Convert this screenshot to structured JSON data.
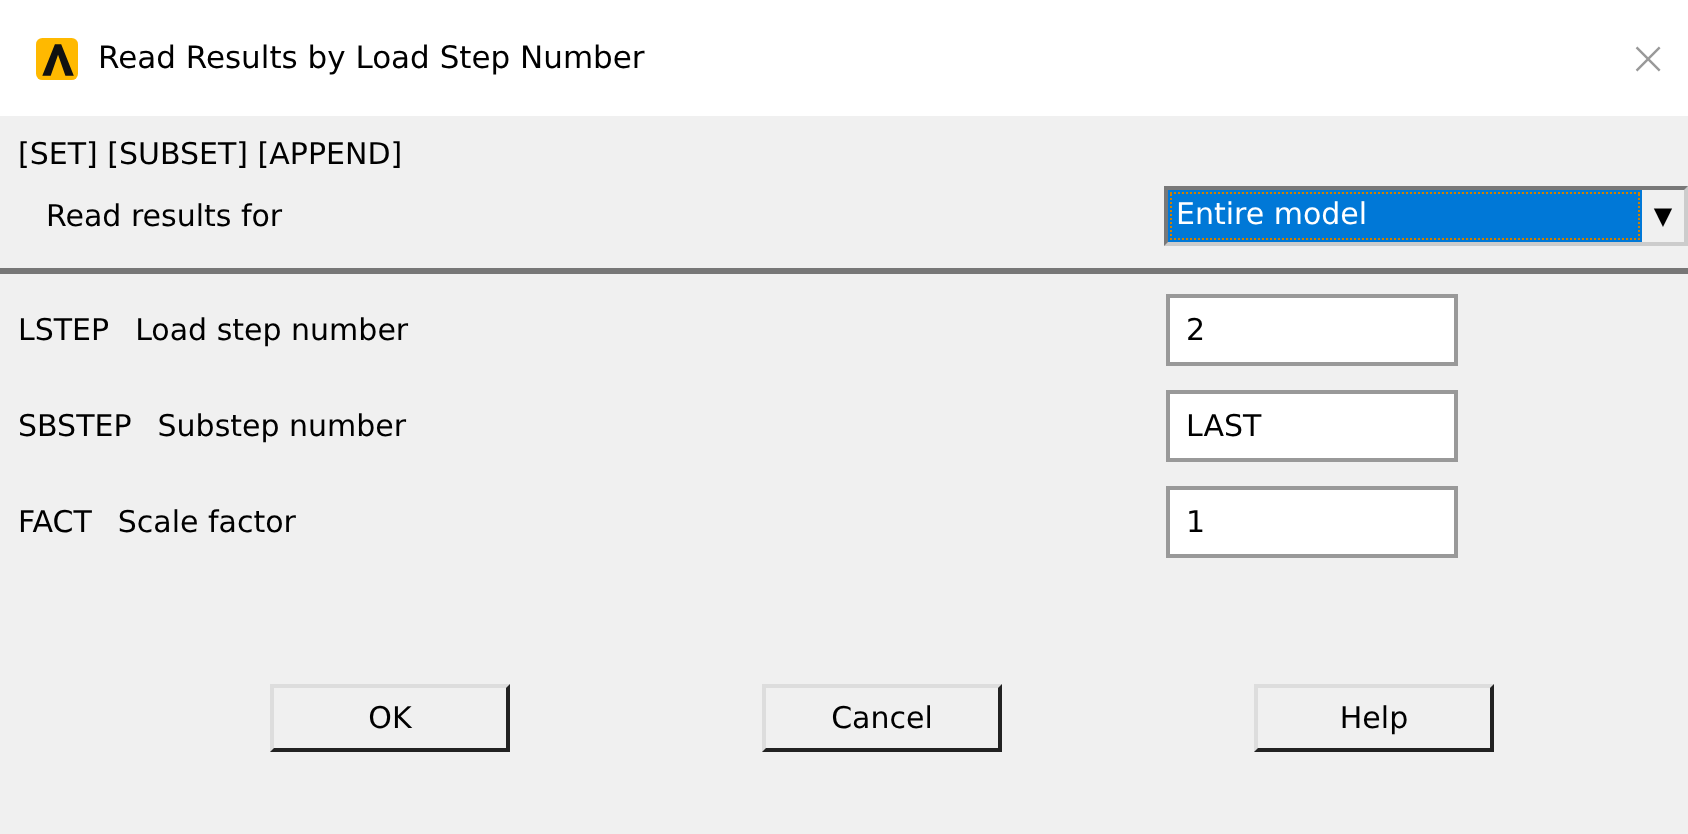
{
  "window": {
    "title": "Read Results by Load Step Number",
    "close": "×"
  },
  "section": {
    "heading": "[SET] [SUBSET] [APPEND]",
    "label": "Read results for",
    "dropdown": {
      "value": "Entire model",
      "arrow": "▼"
    }
  },
  "fields": [
    {
      "code": "LSTEP",
      "label": "Load step number",
      "value": "2"
    },
    {
      "code": "SBSTEP",
      "label": "Substep number",
      "value": "LAST"
    },
    {
      "code": "FACT",
      "label": "Scale factor",
      "value": "1"
    }
  ],
  "buttons": [
    "OK",
    "Cancel",
    "Help"
  ]
}
